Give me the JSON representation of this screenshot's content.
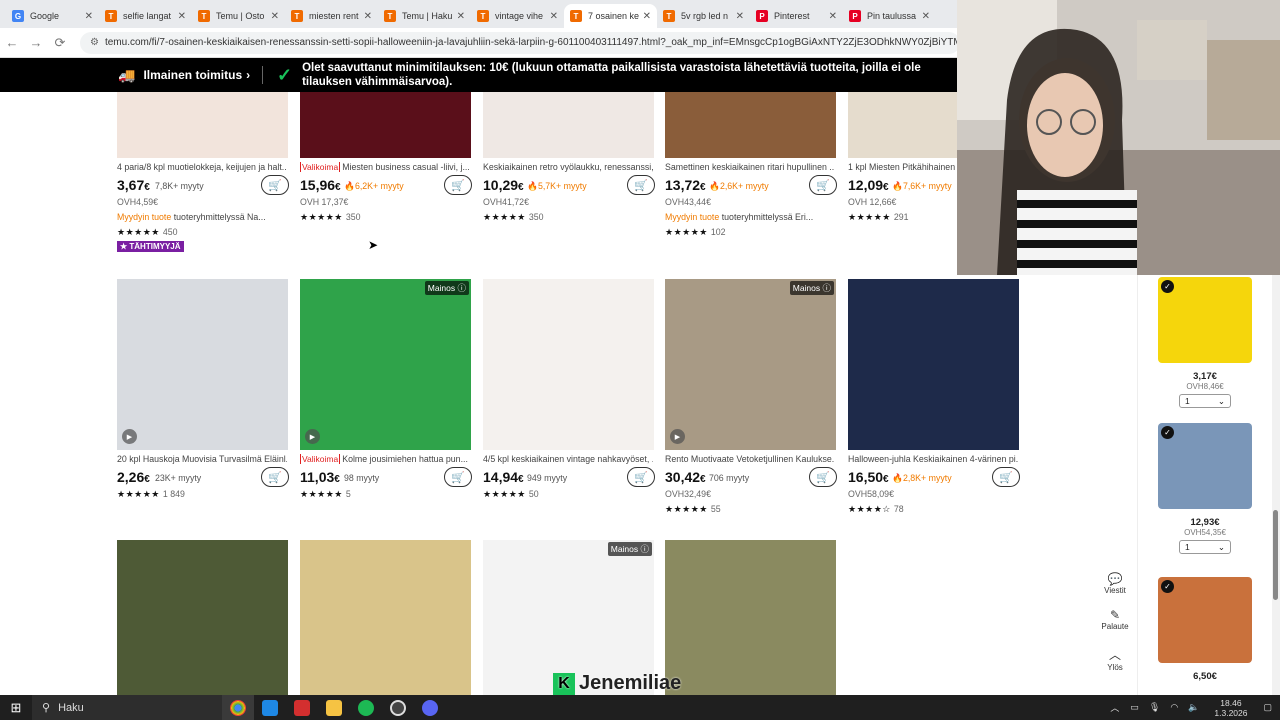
{
  "tabs": [
    {
      "label": "Google",
      "icon": "google-icon",
      "color": "#4285f4",
      "glyph": "G"
    },
    {
      "label": "selfie langat",
      "icon": "temu-icon",
      "color": "#f06a00",
      "glyph": "T"
    },
    {
      "label": "Temu | Osto",
      "icon": "temu-icon",
      "color": "#f06a00",
      "glyph": "T"
    },
    {
      "label": "miesten rent",
      "icon": "temu-icon",
      "color": "#f06a00",
      "glyph": "T"
    },
    {
      "label": "Temu | Haku",
      "icon": "temu-icon",
      "color": "#f06a00",
      "glyph": "T"
    },
    {
      "label": "vintage vihe",
      "icon": "temu-icon",
      "color": "#f06a00",
      "glyph": "T"
    },
    {
      "label": "7 osainen ke",
      "icon": "temu-icon",
      "color": "#f06a00",
      "glyph": "T",
      "active": true
    },
    {
      "label": "5v rgb led n",
      "icon": "temu-icon",
      "color": "#f06a00",
      "glyph": "T"
    },
    {
      "label": "Pinterest",
      "icon": "pinterest-icon",
      "color": "#e60023",
      "glyph": "P"
    },
    {
      "label": "Pin taulussa",
      "icon": "pinterest-icon",
      "color": "#e60023",
      "glyph": "P"
    }
  ],
  "address": {
    "url": "temu.com/fi/7-osainen-keskiaikaisen-renessanssin-setti-sopii-halloweeniin-ja-lavajuhliin-sekä-larpiin-g-601100403111497.html?_oak_mp_inf=EMnsgcCp1ogBGiAxNTY2ZjE3ODhkNWY0ZjBiYTM0YTBmMWUwN"
  },
  "banner": {
    "shipping": "Ilmainen toimitus",
    "message": "Olet saavuttanut minimitilauksen: 10€ (lukuun ottamatta paikallisista varastoista lähetettäviä tuotteita, joilla ei ole tilauksen vähimmäisarvoa)."
  },
  "products_row1": [
    {
      "title": "4 paria/8 kpl muotielokkeja, keijujen ja halt...",
      "price": "3,67",
      "cents": "€",
      "sold": "7,8K+ myyty",
      "hot": false,
      "ovh": "OVH4,59€",
      "stars": "★★★★★",
      "reviews": "450",
      "seller": "Myydyin tuote",
      "seller_rest": " tuoteryhmittelyssä Na...",
      "badge": "★ TÄHTIMYYJÄ",
      "img": "#f2e4dc"
    },
    {
      "title": "Miesten business casual -liivi, j...",
      "valikoima": "Valikoima",
      "price": "15,96",
      "cents": "€",
      "sold": "🔥6,2K+ myyty",
      "hot": true,
      "ovh": "OVH 17,37€",
      "stars": "★★★★★",
      "reviews": "350",
      "img": "#5a0f1a"
    },
    {
      "title": "Keskiaikainen retro vyölaukku, renessanssi,...",
      "price": "10,29",
      "cents": "€",
      "sold": "🔥5,7K+ myyty",
      "hot": true,
      "ovh": "OVH41,72€",
      "stars": "★★★★★",
      "reviews": "350",
      "img": "#efe8e4"
    },
    {
      "title": "Samettinen keskiaikainen ritari hupullinen ...",
      "price": "13,72",
      "cents": "€",
      "sold": "🔥2,6K+ myyty",
      "hot": true,
      "ovh": "OVH43,44€",
      "stars": "★★★★★",
      "reviews": "102",
      "seller": "Myydyin tuote",
      "seller_rest": " tuoteryhmittelyssä Eri...",
      "img": "#8a5d3a"
    },
    {
      "title": "1 kpl Miesten Pitkähihainen ...",
      "price": "12,09",
      "cents": "€",
      "sold": "🔥7,6K+ myyty",
      "hot": true,
      "ovh": "OVH 12,66€",
      "stars": "★★★★★",
      "reviews": "291",
      "img": "#e5dccd"
    }
  ],
  "products_row2": [
    {
      "title": "20 kpl Hauskoja Muovisia Turvasilmä Eläinl...",
      "price": "2,26",
      "cents": "€",
      "sold": "23K+ myyty",
      "hot": false,
      "stars": "★★★★★",
      "reviews": "1 849",
      "img": "#d8dbe0",
      "play": true
    },
    {
      "title": "Kolme jousimiehen hattua pun...",
      "valikoima": "Valikoima",
      "price": "11,03",
      "cents": "€",
      "sold": "98 myyty",
      "hot": false,
      "stars": "★★★★★",
      "reviews": "5",
      "img": "#2fa34a",
      "ad": "Mainos ⓘ",
      "play": true
    },
    {
      "title": "4/5 kpl keskiaikainen vintage nahkavyöset, ...",
      "price": "14,94",
      "cents": "€",
      "sold": "949 myyty",
      "hot": false,
      "stars": "★★★★★",
      "reviews": "50",
      "img": "#f4f1ee"
    },
    {
      "title": "Rento Muotivaate Vetoketjullinen Kaulukse...",
      "price": "30,42",
      "cents": "€",
      "sold": "706 myyty",
      "hot": false,
      "ovh": "OVH32,49€",
      "stars": "★★★★★",
      "reviews": "55",
      "img": "#a89a85",
      "ad": "Mainos ⓘ",
      "play": true
    },
    {
      "title": "Halloween-juhla Keskiaikainen 4-värinen pi...",
      "price": "16,50",
      "cents": "€",
      "sold": "🔥2,8K+ myyty",
      "hot": true,
      "ovh": "OVH58,09€",
      "stars": "★★★★☆",
      "reviews": "78",
      "img": "#1e2a4a"
    }
  ],
  "products_row3": [
    {
      "img": "#4e5a36"
    },
    {
      "img": "#d9c48a"
    },
    {
      "img": "#f3f3f3",
      "ad": "Mainos ⓘ"
    },
    {
      "img": "#8a8a60"
    }
  ],
  "side_cart": [
    {
      "price": "3,17€",
      "ovh": "OVH8,46€",
      "qty": "1",
      "img": "#f5d60c"
    },
    {
      "price": "12,93€",
      "ovh": "OVH54,35€",
      "qty": "1",
      "img": "#7a96b8"
    },
    {
      "price": "6,50€",
      "img": "#c9713c"
    }
  ],
  "fabs": {
    "messages": "Viestit",
    "feedback": "Palaute",
    "up": "Ylös"
  },
  "taskbar": {
    "search": "Haku",
    "time": "18.46",
    "date": "1.3.2026"
  },
  "watermark": "Jenemiliae"
}
